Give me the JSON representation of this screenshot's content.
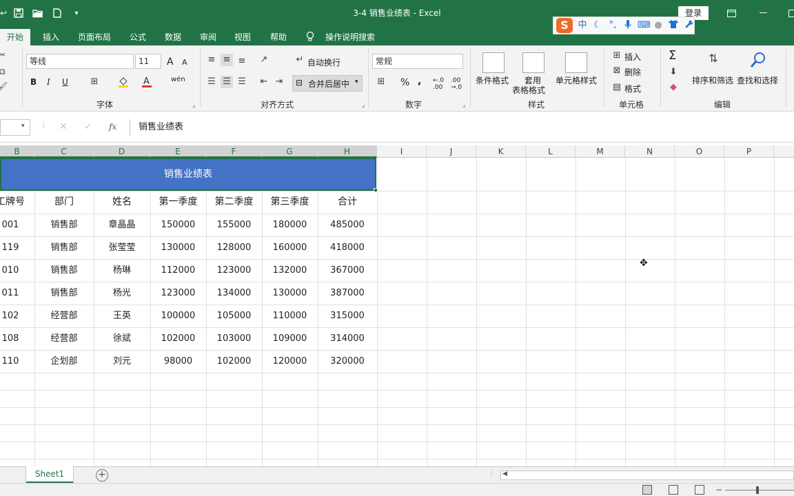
{
  "window": {
    "title": "3-4 销售业绩表  -  Excel",
    "login": "登录"
  },
  "tabs": [
    "开始",
    "插入",
    "页面布局",
    "公式",
    "数据",
    "审阅",
    "视图",
    "帮助",
    "操作说明搜索"
  ],
  "ribbon": {
    "font_name": "等线",
    "font_size": "11",
    "wrap_text": "自动换行",
    "merge_center": "合并后居中",
    "number_format": "常规",
    "conditional_format": "条件格式",
    "table_format_1": "套用",
    "table_format_2": "表格格式",
    "cell_styles": "单元格样式",
    "insert": "插入",
    "delete": "删除",
    "format": "格式",
    "sort_filter": "排序和筛选",
    "find_select": "查找和选择",
    "group_font": "字体",
    "group_align": "对齐方式",
    "group_number": "数字",
    "group_styles": "样式",
    "group_cells": "单元格",
    "group_edit": "编辑",
    "bold": "B",
    "italic": "I",
    "underline": "U",
    "grow_font": "A",
    "shrink_font": "A",
    "wen": "wén",
    "percent": "%",
    "comma": ",",
    "sigma": "Σ"
  },
  "ime": {
    "logo": "S",
    "mode": "中"
  },
  "formula_bar": {
    "content": "销售业绩表",
    "fx": "fx"
  },
  "columns": [
    "B",
    "C",
    "D",
    "E",
    "F",
    "G",
    "H",
    "I",
    "J",
    "K",
    "L",
    "M",
    "N",
    "O",
    "P"
  ],
  "sheet_title": "销售业绩表",
  "table": {
    "headers": [
      "工牌号",
      "部门",
      "姓名",
      "第一季度",
      "第二季度",
      "第三季度",
      "合计"
    ],
    "rows": [
      [
        "001",
        "销售部",
        "章晶晶",
        "150000",
        "155000",
        "180000",
        "485000"
      ],
      [
        "119",
        "销售部",
        "张莹莹",
        "130000",
        "128000",
        "160000",
        "418000"
      ],
      [
        "010",
        "销售部",
        "杨琳",
        "112000",
        "123000",
        "132000",
        "367000"
      ],
      [
        "011",
        "销售部",
        "杨光",
        "123000",
        "134000",
        "130000",
        "387000"
      ],
      [
        "102",
        "经营部",
        "王英",
        "100000",
        "105000",
        "110000",
        "315000"
      ],
      [
        "108",
        "经营部",
        "徐斌",
        "102000",
        "103000",
        "109000",
        "314000"
      ],
      [
        "110",
        "企划部",
        "刘元",
        "98000",
        "102000",
        "120000",
        "320000"
      ]
    ]
  },
  "sheet_tab": "Sheet1",
  "colors": {
    "excel_green": "#217346",
    "title_band": "#4472c4"
  }
}
